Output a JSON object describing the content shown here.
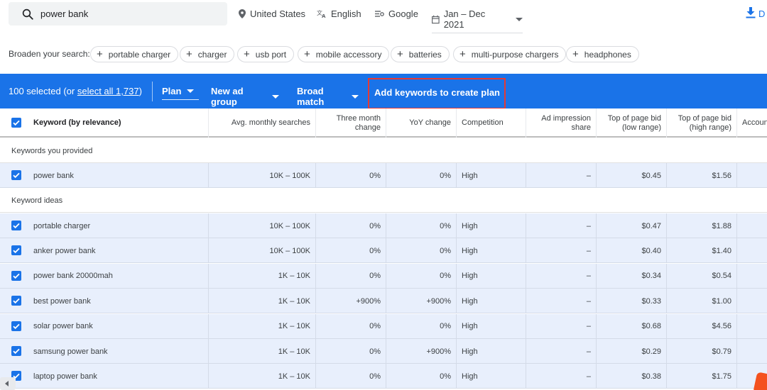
{
  "search": {
    "query": "power bank"
  },
  "filters": {
    "location": "United States",
    "language": "English",
    "network": "Google",
    "date_range": "Jan – Dec 2021"
  },
  "download": {
    "label": "D"
  },
  "broaden": {
    "label": "Broaden your search:",
    "chips": [
      "portable charger",
      "charger",
      "usb port",
      "mobile accessory",
      "batteries",
      "multi-purpose chargers",
      "headphones"
    ]
  },
  "actionbar": {
    "selected_text": "100 selected (or ",
    "select_all": "select all 1,737",
    "selected_close": ")",
    "plan": "Plan",
    "new_ad_group": "New ad group",
    "broad_match": "Broad match",
    "add_keywords": "Add keywords to create plan"
  },
  "table": {
    "headers": {
      "keyword": "Keyword (by relevance)",
      "avg": "Avg. monthly searches",
      "three_month": [
        "Three month",
        "change"
      ],
      "yoy": "YoY change",
      "competition": "Competition",
      "ad_impression": [
        "Ad impression",
        "share"
      ],
      "bid_low": [
        "Top of page bid",
        "(low range)"
      ],
      "bid_high": [
        "Top of page bid",
        "(high range)"
      ],
      "account": "Account"
    },
    "section_provided": "Keywords you provided",
    "section_ideas": "Keyword ideas",
    "provided_rows": [
      {
        "keyword": "power bank",
        "avg": "10K – 100K",
        "three_month": "0%",
        "yoy": "0%",
        "competition": "High",
        "ad_share": "–",
        "bid_low": "$0.45",
        "bid_high": "$1.56"
      }
    ],
    "idea_rows": [
      {
        "keyword": "portable charger",
        "avg": "10K – 100K",
        "three_month": "0%",
        "yoy": "0%",
        "competition": "High",
        "ad_share": "–",
        "bid_low": "$0.47",
        "bid_high": "$1.88"
      },
      {
        "keyword": "anker power bank",
        "avg": "10K – 100K",
        "three_month": "0%",
        "yoy": "0%",
        "competition": "High",
        "ad_share": "–",
        "bid_low": "$0.40",
        "bid_high": "$1.40"
      },
      {
        "keyword": "power bank 20000mah",
        "avg": "1K – 10K",
        "three_month": "0%",
        "yoy": "0%",
        "competition": "High",
        "ad_share": "–",
        "bid_low": "$0.34",
        "bid_high": "$0.54"
      },
      {
        "keyword": "best power bank",
        "avg": "1K – 10K",
        "three_month": "+900%",
        "yoy": "+900%",
        "competition": "High",
        "ad_share": "–",
        "bid_low": "$0.33",
        "bid_high": "$1.00"
      },
      {
        "keyword": "solar power bank",
        "avg": "1K – 10K",
        "three_month": "0%",
        "yoy": "0%",
        "competition": "High",
        "ad_share": "–",
        "bid_low": "$0.68",
        "bid_high": "$4.56"
      },
      {
        "keyword": "samsung power bank",
        "avg": "1K – 10K",
        "three_month": "0%",
        "yoy": "+900%",
        "competition": "High",
        "ad_share": "–",
        "bid_low": "$0.29",
        "bid_high": "$0.79"
      },
      {
        "keyword": "laptop power bank",
        "avg": "1K – 10K",
        "three_month": "0%",
        "yoy": "0%",
        "competition": "High",
        "ad_share": "–",
        "bid_low": "$0.38",
        "bid_high": "$1.75"
      }
    ]
  },
  "colors": {
    "accent": "#1a73e8",
    "row_selected": "#e8effc",
    "highlight_box": "#e53935"
  }
}
